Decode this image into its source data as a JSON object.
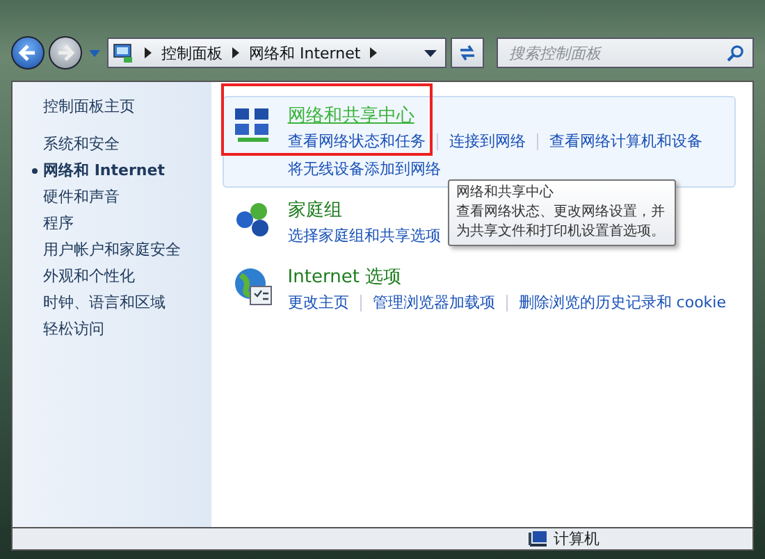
{
  "navigation": {
    "breadcrumb": [
      "控制面板",
      "网络和 Internet"
    ],
    "search": {
      "placeholder": "搜索控制面板"
    }
  },
  "sidebar": {
    "home": "控制面板主页",
    "items": [
      {
        "label": "系统和安全",
        "selected": false
      },
      {
        "label": "网络和 Internet",
        "selected": true
      },
      {
        "label": "硬件和声音",
        "selected": false
      },
      {
        "label": "程序",
        "selected": false
      },
      {
        "label": "用户帐户和家庭安全",
        "selected": false
      },
      {
        "label": "外观和个性化",
        "selected": false
      },
      {
        "label": "时钟、语言和区域",
        "selected": false
      },
      {
        "label": "轻松访问",
        "selected": false
      }
    ]
  },
  "sections": [
    {
      "title": "网络和共享中心",
      "highlighted": true,
      "annotated": true,
      "link_rows": [
        [
          "查看网络状态和任务",
          "连接到网络",
          "查看网络计算机和设备"
        ],
        [
          "将无线设备添加到网络"
        ]
      ]
    },
    {
      "title": "家庭组",
      "highlighted": false,
      "annotated": false,
      "link_rows": [
        [
          "选择家庭组和共享选项"
        ]
      ]
    },
    {
      "title": "Internet 选项",
      "highlighted": false,
      "annotated": false,
      "link_rows": [
        [
          "更改主页",
          "管理浏览器加载项",
          "删除浏览的历史记录和 cookie"
        ]
      ]
    }
  ],
  "tooltip": {
    "title": "网络和共享中心",
    "text": "查看网络状态、更改网络设置，并为共享文件和打印机设置首选项。"
  },
  "status_bar": {
    "location": "计算机"
  }
}
